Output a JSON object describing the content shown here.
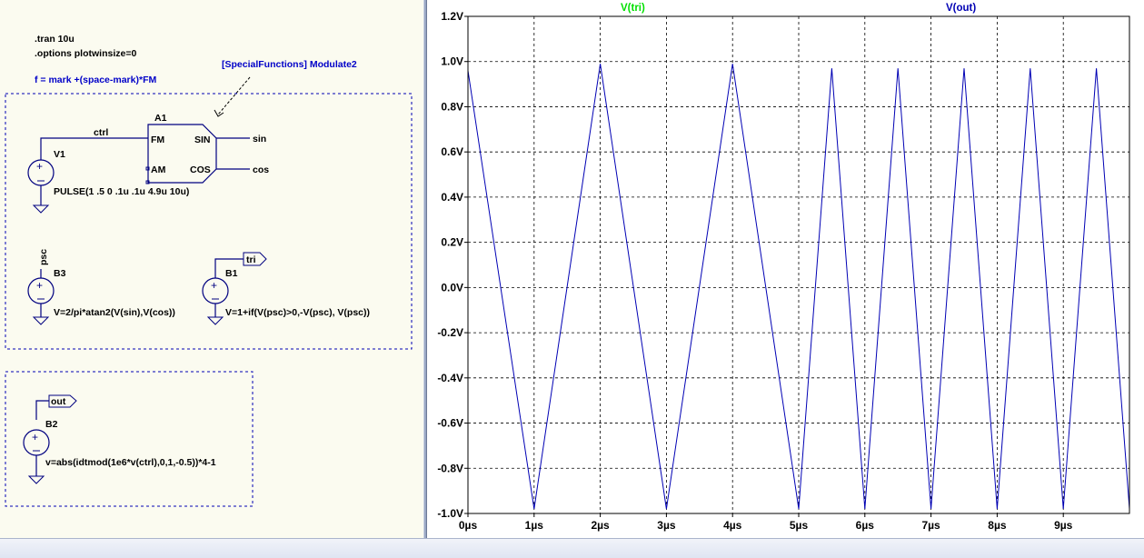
{
  "schematic": {
    "directives": [
      ".tran 10u",
      ".options plotwinsize=0"
    ],
    "formula": "f = mark +(space-mark)*FM",
    "annotation": "[SpecialFunctions] Modulate2",
    "a1": {
      "ref": "A1",
      "pin_fm": "FM",
      "pin_am": "AM",
      "pin_sin": "SIN",
      "pin_cos": "COS"
    },
    "nets": {
      "ctrl": "ctrl",
      "sin": "sin",
      "cos": "cos",
      "psc": "psc",
      "tri": "tri",
      "out": "out"
    },
    "v1": {
      "ref": "V1",
      "value": "PULSE(1 .5 0 .1u .1u 4.9u 10u)"
    },
    "b3": {
      "ref": "B3",
      "value": "V=2/pi*atan2(V(sin),V(cos))"
    },
    "b1": {
      "ref": "B1",
      "value": "V=1+if(V(psc)>0,-V(psc), V(psc))"
    },
    "b2": {
      "ref": "B2",
      "value": "v=abs(idtmod(1e6*v(ctrl),0,1,-0.5))*4-1"
    }
  },
  "plot": {
    "traces": [
      {
        "name": "V(tri)",
        "color": "#00e000"
      },
      {
        "name": "V(out)",
        "color": "#0000b4"
      }
    ],
    "y_tick_labels": [
      "1.2V",
      "1.0V",
      "0.8V",
      "0.6V",
      "0.4V",
      "0.2V",
      "0.0V",
      "-0.2V",
      "-0.4V",
      "-0.6V",
      "-0.8V",
      "-1.0V"
    ],
    "x_tick_labels": [
      "0µs",
      "1µs",
      "2µs",
      "3µs",
      "4µs",
      "5µs",
      "6µs",
      "7µs",
      "8µs",
      "9µs"
    ]
  },
  "chart_data": {
    "type": "line",
    "xlabel": "",
    "ylabel": "",
    "xlim": [
      0,
      10
    ],
    "ylim": [
      -1.0,
      1.2
    ],
    "x_unit": "µs",
    "y_unit": "V",
    "grid": true,
    "series": [
      {
        "name": "V(out)",
        "color": "#0000b4",
        "x": [
          0,
          1,
          2,
          3,
          4,
          5,
          5.5,
          6,
          6.5,
          7,
          7.5,
          8,
          8.5,
          9,
          9.5,
          10
        ],
        "values": [
          0.96,
          -0.98,
          0.99,
          -0.98,
          0.99,
          -0.98,
          0.97,
          -0.98,
          0.97,
          -0.98,
          0.97,
          -0.98,
          0.97,
          -0.98,
          0.97,
          -0.98
        ]
      }
    ]
  }
}
